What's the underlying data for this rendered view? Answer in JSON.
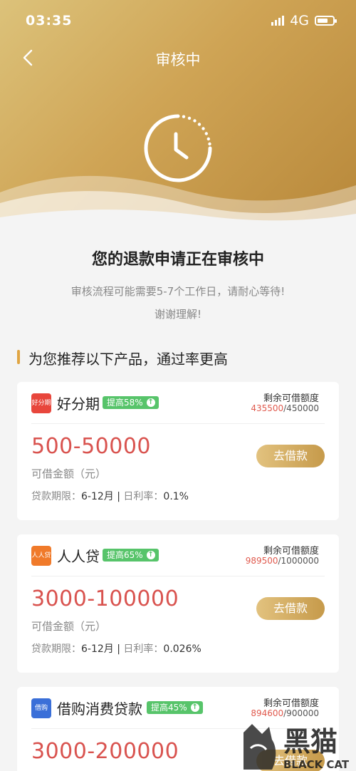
{
  "status_bar": {
    "time": "03:35",
    "network": "4G"
  },
  "nav": {
    "title": "审核中"
  },
  "status": {
    "title": "您的退款申请正在审核中",
    "line1": "审核流程可能需要5-7个工作日，请耐心等待!",
    "line2": "谢谢理解!"
  },
  "section": {
    "title": "为您推荐以下产品，通过率更高"
  },
  "products": [
    {
      "logo_text": "好分期",
      "logo_color": "#e8463c",
      "name": "好分期",
      "badge": "提高58%",
      "remain_label": "剩余可借额度",
      "remain_used": "435500",
      "remain_total": "/450000",
      "amount": "500-50000",
      "amount_label": "可借金额（元）",
      "term_label": "贷款期限：",
      "term_value": "6-12月",
      "rate_label": "日利率：",
      "rate_value": "0.1%",
      "button": "去借款"
    },
    {
      "logo_text": "人人贷",
      "logo_color": "#f07a2a",
      "name": "人人贷",
      "badge": "提高65%",
      "remain_label": "剩余可借额度",
      "remain_used": "989500",
      "remain_total": "/1000000",
      "amount": "3000-100000",
      "amount_label": "可借金额（元）",
      "term_label": "贷款期限：",
      "term_value": "6-12月",
      "rate_label": "日利率：",
      "rate_value": "0.026%",
      "button": "去借款"
    },
    {
      "logo_text": "借购",
      "logo_color": "#3a6fd8",
      "name": "借购消费贷款",
      "badge": "提高45%",
      "remain_label": "剩余可借额度",
      "remain_used": "894600",
      "remain_total": "/900000",
      "amount": "3000-200000",
      "button": "去借款"
    }
  ],
  "watermark": {
    "text": "黑猫",
    "sub": "BLACK CAT"
  }
}
